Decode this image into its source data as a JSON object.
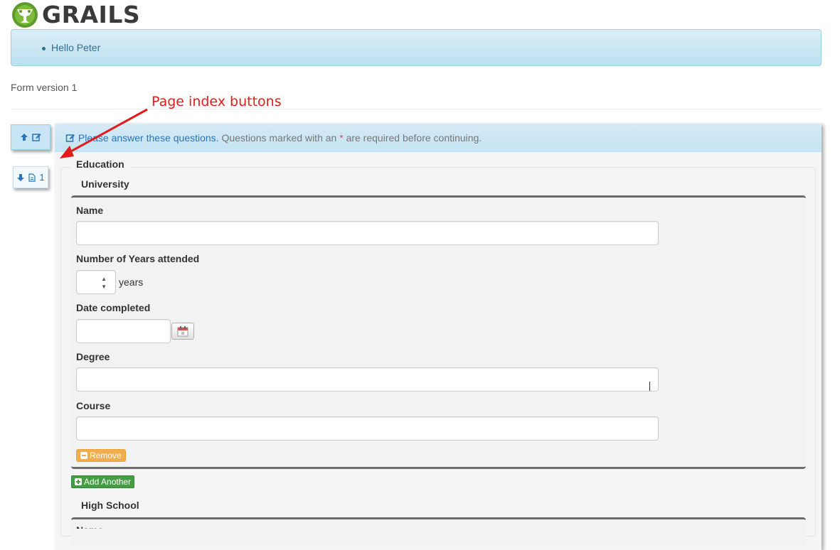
{
  "app": {
    "logo_text": "GRAILS"
  },
  "alert": {
    "items": [
      "Hello Peter"
    ]
  },
  "form_version": "Form version 1",
  "annotation": {
    "text": "Page index buttons",
    "color": "#e41b1b"
  },
  "page_index": {
    "buttons": [
      {
        "icon": "arrow-up-icon",
        "icon2": "edit-icon",
        "label": ""
      },
      {
        "icon": "arrow-down-icon",
        "icon2": "document-icon",
        "label": "1"
      }
    ]
  },
  "instructions": {
    "lead": "Please answer these questions.",
    "text_before": "Questions marked with an",
    "required_mark": "*",
    "text_after": "are required before continuing."
  },
  "section": {
    "legend": "Education",
    "groups": [
      {
        "legend": "University",
        "fields": [
          {
            "label": "Name",
            "value": ""
          },
          {
            "label": "Number of Years attended",
            "value": "",
            "unit": "years"
          },
          {
            "label": "Date completed",
            "value": ""
          },
          {
            "label": "Degree",
            "value": ""
          },
          {
            "label": "Course",
            "value": ""
          }
        ],
        "remove_label": "Remove",
        "add_label": "Add Another"
      },
      {
        "legend": "High School",
        "fields": [
          {
            "label": "Name",
            "value": ""
          }
        ]
      }
    ]
  },
  "colors": {
    "alert_text": "#31708f",
    "link_blue": "#2a74b8",
    "remove_orange": "#f0ad4e",
    "add_green": "#449d44",
    "required_red": "#d9534f"
  }
}
